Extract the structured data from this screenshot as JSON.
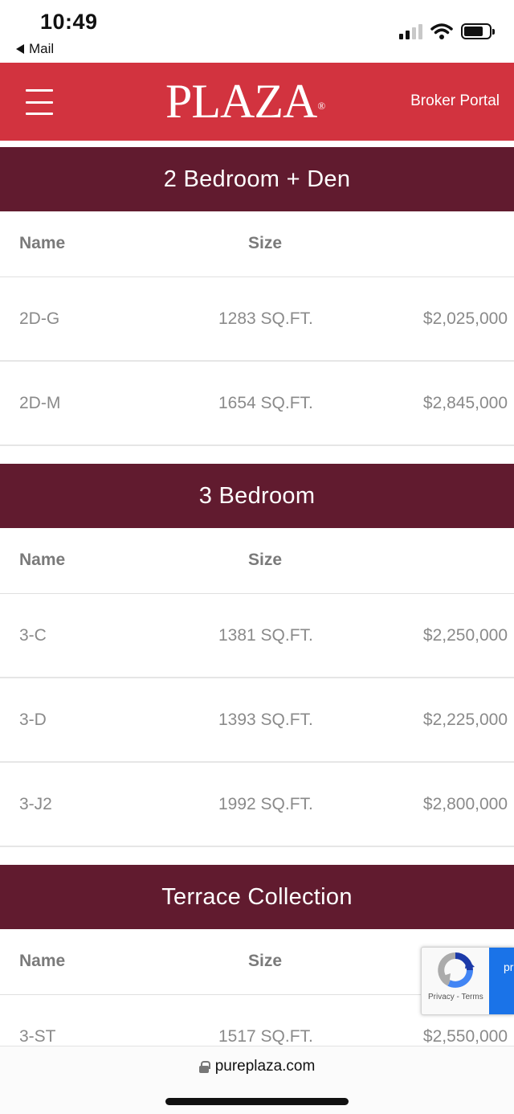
{
  "status_bar": {
    "time": "10:49",
    "back_label": "Mail"
  },
  "header": {
    "logo": "PLAZA",
    "logo_mark": "®",
    "broker_link": "Broker Portal"
  },
  "columns": {
    "name": "Name",
    "size": "Size"
  },
  "sections": [
    {
      "title": "2 Bedroom + Den",
      "units": [
        {
          "name": "2D-G",
          "size": "1283 SQ.FT.",
          "price": "$2,025,000"
        },
        {
          "name": "2D-M",
          "size": "1654 SQ.FT.",
          "price": "$2,845,000"
        }
      ]
    },
    {
      "title": "3 Bedroom",
      "units": [
        {
          "name": "3-C",
          "size": "1381 SQ.FT.",
          "price": "$2,250,000"
        },
        {
          "name": "3-D",
          "size": "1393 SQ.FT.",
          "price": "$2,225,000"
        },
        {
          "name": "3-J2",
          "size": "1992 SQ.FT.",
          "price": "$2,800,000"
        }
      ]
    },
    {
      "title": "Terrace Collection",
      "units": [
        {
          "name": "3-ST",
          "size": "1517 SQ.FT.",
          "price": "$2,550,000"
        }
      ]
    }
  ],
  "recaptcha": {
    "links": "Privacy - Terms",
    "side_text": "pr"
  },
  "browser": {
    "url": "pureplaza.com"
  },
  "colors": {
    "header_red": "#d2333f",
    "section_maroon": "#611b2f",
    "text_gray": "#8a8a8a"
  }
}
